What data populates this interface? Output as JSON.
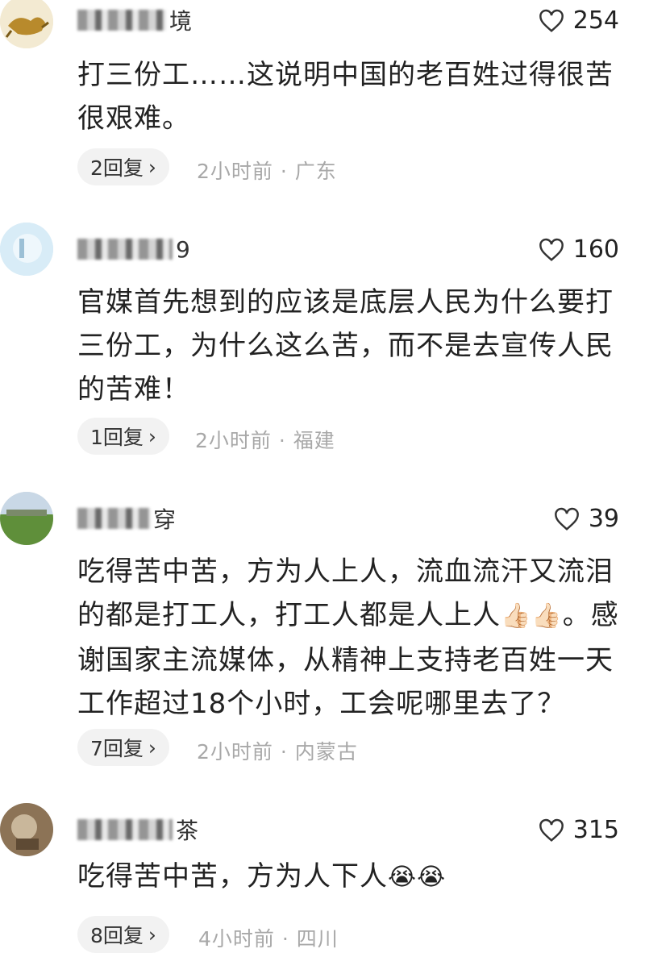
{
  "comments": [
    {
      "name_visible": "境",
      "likes": "254",
      "text": "打三份工……这说明中国的老百姓过得很苦很艰难。",
      "replies": "2回复",
      "time": "2小时前",
      "separator": "·",
      "location": "广东"
    },
    {
      "name_visible": "9",
      "likes": "160",
      "text": "官媒首先想到的应该是底层人民为什么要打三份工，为什么这么苦，而不是去宣传人民的苦难！",
      "replies": "1回复",
      "time": "2小时前",
      "separator": "·",
      "location": "福建"
    },
    {
      "name_visible": "穿",
      "likes": "39",
      "text_part1": "吃得苦中苦，方为人上人，流血流汗又流泪的都是打工人，打工人都是人上人",
      "emoji1": "👍🏻",
      "emoji2": "👍🏻",
      "text_part2": "。感谢国家主流媒体，从精神上支持老百姓一天工作超过18个小时，工会呢哪里去了？",
      "replies": "7回复",
      "time": "2小时前",
      "separator": "·",
      "location": "内蒙古"
    },
    {
      "name_visible": "茶",
      "likes": "315",
      "text": "吃得苦中苦，方为人下人",
      "emoji1": "😭",
      "emoji2": "😭",
      "replies": "8回复",
      "time": "4小时前",
      "separator": "·",
      "location": "四川"
    }
  ],
  "icons": {
    "like": "heart-outline-icon",
    "reply_chevron": "chevron-right-icon"
  },
  "colors": {
    "text": "#222222",
    "meta": "#a8a8a8",
    "reply_bg": "#f2f2f2"
  }
}
